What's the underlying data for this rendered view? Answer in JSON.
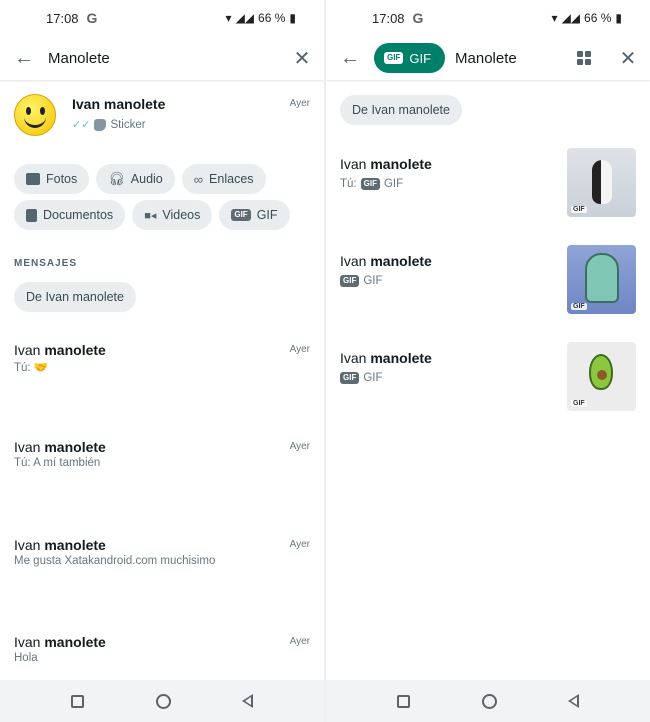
{
  "status": {
    "time": "17:08",
    "g": "G",
    "battery": "66 %"
  },
  "left": {
    "search_value": "Manolete",
    "sticker_result": {
      "name": "Ivan manolete",
      "type": "Sticker",
      "when": "Ayer"
    },
    "filters": [
      "Fotos",
      "Audio",
      "Enlaces",
      "Documentos",
      "Videos",
      "GIF"
    ],
    "section_title": "MENSAJES",
    "from_chip": "De Ivan manolete",
    "messages": [
      {
        "name_a": "Ivan",
        "name_b": "manolete",
        "text": "Tú: 🤝",
        "when": "Ayer"
      },
      {
        "name_a": "Ivan",
        "name_b": "manolete",
        "text": "Tú: A mí también",
        "when": "Ayer"
      },
      {
        "name_a": "Ivan",
        "name_b": "manolete",
        "text": "Me gusta Xatakandroid.com muchisimo",
        "when": "Ayer"
      },
      {
        "name_a": "Ivan",
        "name_b": "manolete",
        "text": "Hola",
        "when": "Ayer"
      }
    ]
  },
  "right": {
    "filter_pill": "GIF",
    "search_value": "Manolete",
    "from_chip": "De Ivan manolete",
    "gif_badge": "GIF",
    "results": [
      {
        "name_a": "Ivan",
        "name_b": "manolete",
        "prefix": "Tú:",
        "label": "GIF",
        "thumb": "penguin"
      },
      {
        "name_a": "Ivan",
        "name_b": "manolete",
        "prefix": "",
        "label": "GIF",
        "thumb": "squidward"
      },
      {
        "name_a": "Ivan",
        "name_b": "manolete",
        "prefix": "",
        "label": "GIF",
        "thumb": "avocado"
      }
    ]
  }
}
